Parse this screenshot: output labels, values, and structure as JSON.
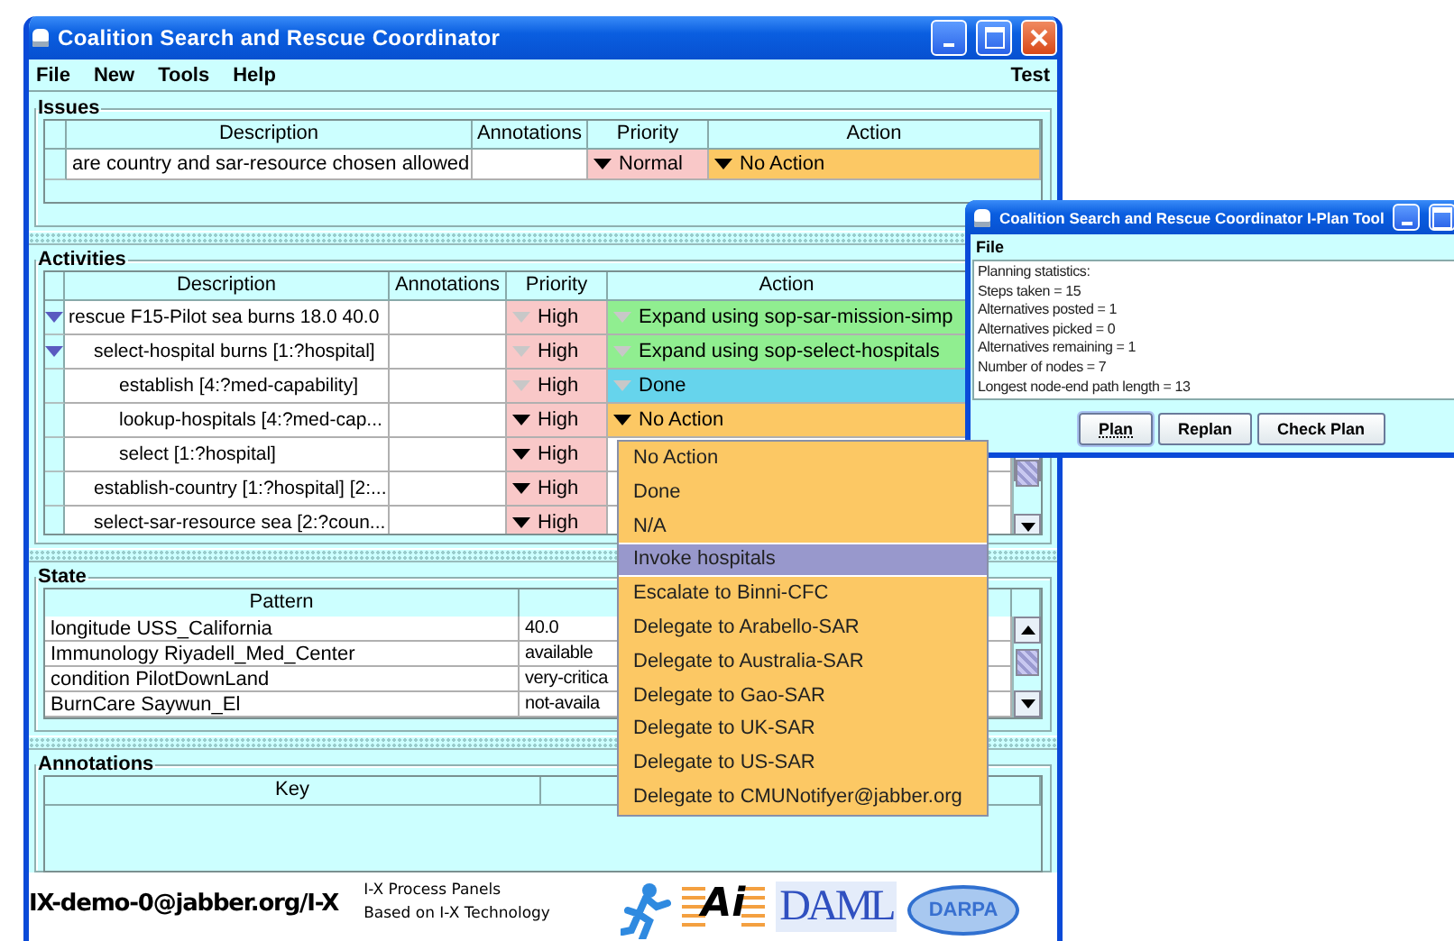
{
  "main_window": {
    "title": "Coalition Search and Rescue Coordinator",
    "menu": [
      "File",
      "New",
      "Tools",
      "Help"
    ],
    "menu_right": "Test",
    "issues": {
      "title": "Issues",
      "columns": [
        "Description",
        "Annotations",
        "Priority",
        "Action"
      ],
      "rows": [
        {
          "description": "are country and sar-resource chosen allowed",
          "priority": "Normal",
          "priority_locked": false,
          "action": "No Action",
          "action_locked": false,
          "color": "#fcc864"
        }
      ]
    },
    "activities": {
      "title": "Activities",
      "columns": [
        "Description",
        "Annotations",
        "Priority",
        "Action"
      ],
      "rows": [
        {
          "description": "rescue F15-Pilot sea burns 18.0 40.0",
          "priority": "High",
          "priority_locked": true,
          "action": "Expand using sop-sar-mission-simp",
          "action_locked": true,
          "color": "#90ee90",
          "expanded": true,
          "children": [
            {
              "description": "select-hospital burns [1:?hospital]",
              "priority": "High",
              "priority_locked": true,
              "action": "Expand using sop-select-hospitals",
              "action_locked": true,
              "color": "#90ee90",
              "expanded": true,
              "children": [
                {
                  "description": "establish [4:?med-capability]",
                  "priority": "High",
                  "priority_locked": true,
                  "action": "Done",
                  "action_locked": true,
                  "color": "#66d4ec"
                },
                {
                  "description": "lookup-hospitals [4:?med-cap...",
                  "priority": "High",
                  "priority_locked": false,
                  "action": "No Action",
                  "action_locked": false,
                  "color": "#fcc864"
                },
                {
                  "description": "select [1:?hospital]",
                  "priority": "High",
                  "priority_locked": false
                }
              ]
            },
            {
              "description": "establish-country [1:?hospital] [2:...",
              "priority": "High",
              "priority_locked": false
            },
            {
              "description": "select-sar-resource sea [2:?coun...",
              "priority": "High",
              "priority_locked": false
            }
          ]
        }
      ]
    },
    "state": {
      "title": "State",
      "columns": [
        "Pattern"
      ],
      "rows": [
        {
          "pattern": "longitude USS_California",
          "value": "40.0"
        },
        {
          "pattern": "Immunology Riyadell_Med_Center",
          "value": "available"
        },
        {
          "pattern": "condition PilotDownLand",
          "value": "very-critica"
        },
        {
          "pattern": "BurnCare Saywun_El",
          "value": "not-availa"
        }
      ]
    },
    "annotations": {
      "title": "Annotations",
      "columns": [
        "Key"
      ]
    },
    "footer": {
      "address": "IX-demo-0@jabber.org/I-X",
      "lines": [
        "I-X Process Panels",
        "Based on I-X Technology"
      ],
      "logos": [
        {
          "kind": "figure"
        },
        {
          "kind": "ai",
          "text": "Ai"
        },
        {
          "kind": "daml",
          "text": "DAML"
        },
        {
          "kind": "darpa",
          "text": "DARPA"
        }
      ]
    }
  },
  "plan_window": {
    "title": "Coalition Search and Rescue Coordinator I-Plan Tool",
    "menu": [
      "File"
    ],
    "lines": [
      "Planning statistics:",
      "Steps taken = 15",
      "Alternatives posted = 1",
      "Alternatives picked = 0",
      "Alternatives remaining = 1",
      "Number of nodes = 7",
      "Longest node-end path length = 13"
    ],
    "buttons": [
      {
        "label": "Plan",
        "focused": true
      },
      {
        "label": "Replan",
        "focused": false
      },
      {
        "label": "Check Plan",
        "focused": false
      }
    ]
  },
  "action_menu": {
    "items": [
      {
        "label": "No Action",
        "selected": false
      },
      {
        "label": "Done",
        "selected": false
      },
      {
        "label": "N/A",
        "selected": false
      },
      {
        "label": "Invoke hospitals",
        "selected": true
      },
      {
        "label": "Escalate to Binni-CFC",
        "selected": false
      },
      {
        "label": "Delegate to Arabello-SAR",
        "selected": false
      },
      {
        "label": "Delegate to Australia-SAR",
        "selected": false
      },
      {
        "label": "Delegate to Gao-SAR",
        "selected": false
      },
      {
        "label": "Delegate to UK-SAR",
        "selected": false
      },
      {
        "label": "Delegate to US-SAR",
        "selected": false
      },
      {
        "label": "Delegate to CMUNotifyer@jabber.org",
        "selected": false
      }
    ]
  }
}
